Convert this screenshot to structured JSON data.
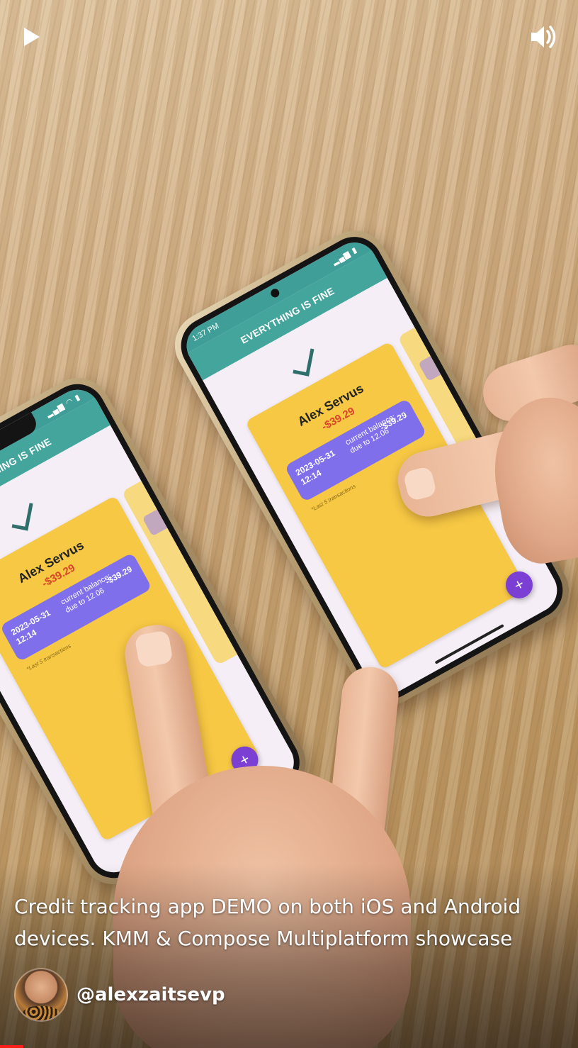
{
  "player": {
    "caption": "Credit tracking app DEMO on both iOS and Android devices. KMM & Compose Multiplatform showcase",
    "channel_handle": "@alexzaitsevp",
    "progress": 0.04,
    "controls": {
      "play_icon": "play-icon",
      "volume_icon": "volume-icon"
    }
  },
  "ios_app": {
    "title": "EVERYTHING IS FINE",
    "card": {
      "name": "Alex Servus",
      "balance": "-$39.29",
      "transaction": {
        "date": "2023-05-31 12:14",
        "description": "current balance; due to 12.06",
        "amount": "-$39.29"
      },
      "footnote": "*Last 5 transactions"
    },
    "fab_label": "+"
  },
  "android_app": {
    "status_time": "1:37 PM",
    "title": "EVERYTHING IS FINE",
    "card": {
      "name": "Alex Servus",
      "balance": "-$39.29",
      "transaction": {
        "date": "2023-05-31 12:14",
        "description": "current balance; due to 12.06",
        "amount": "-$39.29"
      },
      "footnote": "*Last 5 transactions"
    },
    "fab_label": "+"
  },
  "colors": {
    "appbar": "#44a59d",
    "card": "#f6c844",
    "transaction_chip": "#7f6fea",
    "fab": "#7c3fd3",
    "balance_negative": "#d9452b",
    "progress": "#ff1e1e"
  }
}
